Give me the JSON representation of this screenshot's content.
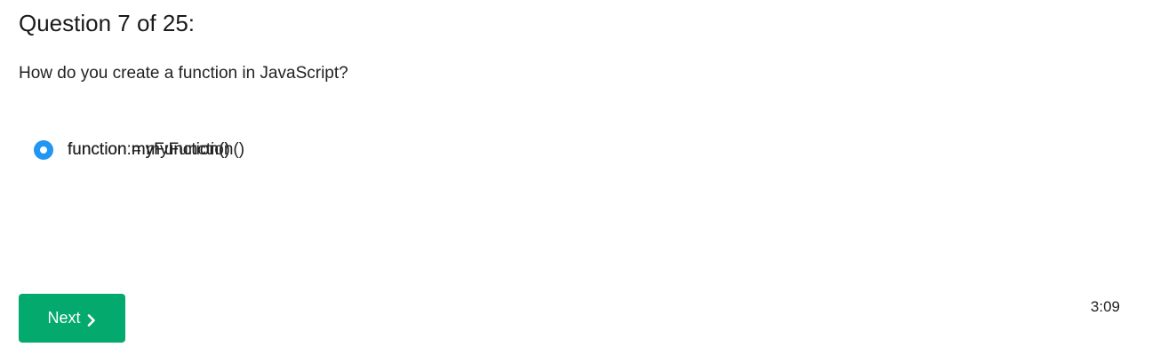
{
  "question": {
    "title": "Question 7 of 25:",
    "text": "How do you create a function in JavaScript?"
  },
  "options": [
    {
      "label": "function = myFunction()",
      "selected": false
    },
    {
      "label": "function:myFunction()",
      "selected": false
    },
    {
      "label": "function myFunction()",
      "selected": true
    }
  ],
  "next_button": {
    "label": "Next",
    "icon": "chevron-right-icon"
  },
  "timer": "3:09",
  "colors": {
    "option_bg": "#e8e9eb",
    "option_selected_bg": "#dcdcdc",
    "radio_selected": "#2196f3",
    "next_button_bg": "#04aa6d"
  }
}
